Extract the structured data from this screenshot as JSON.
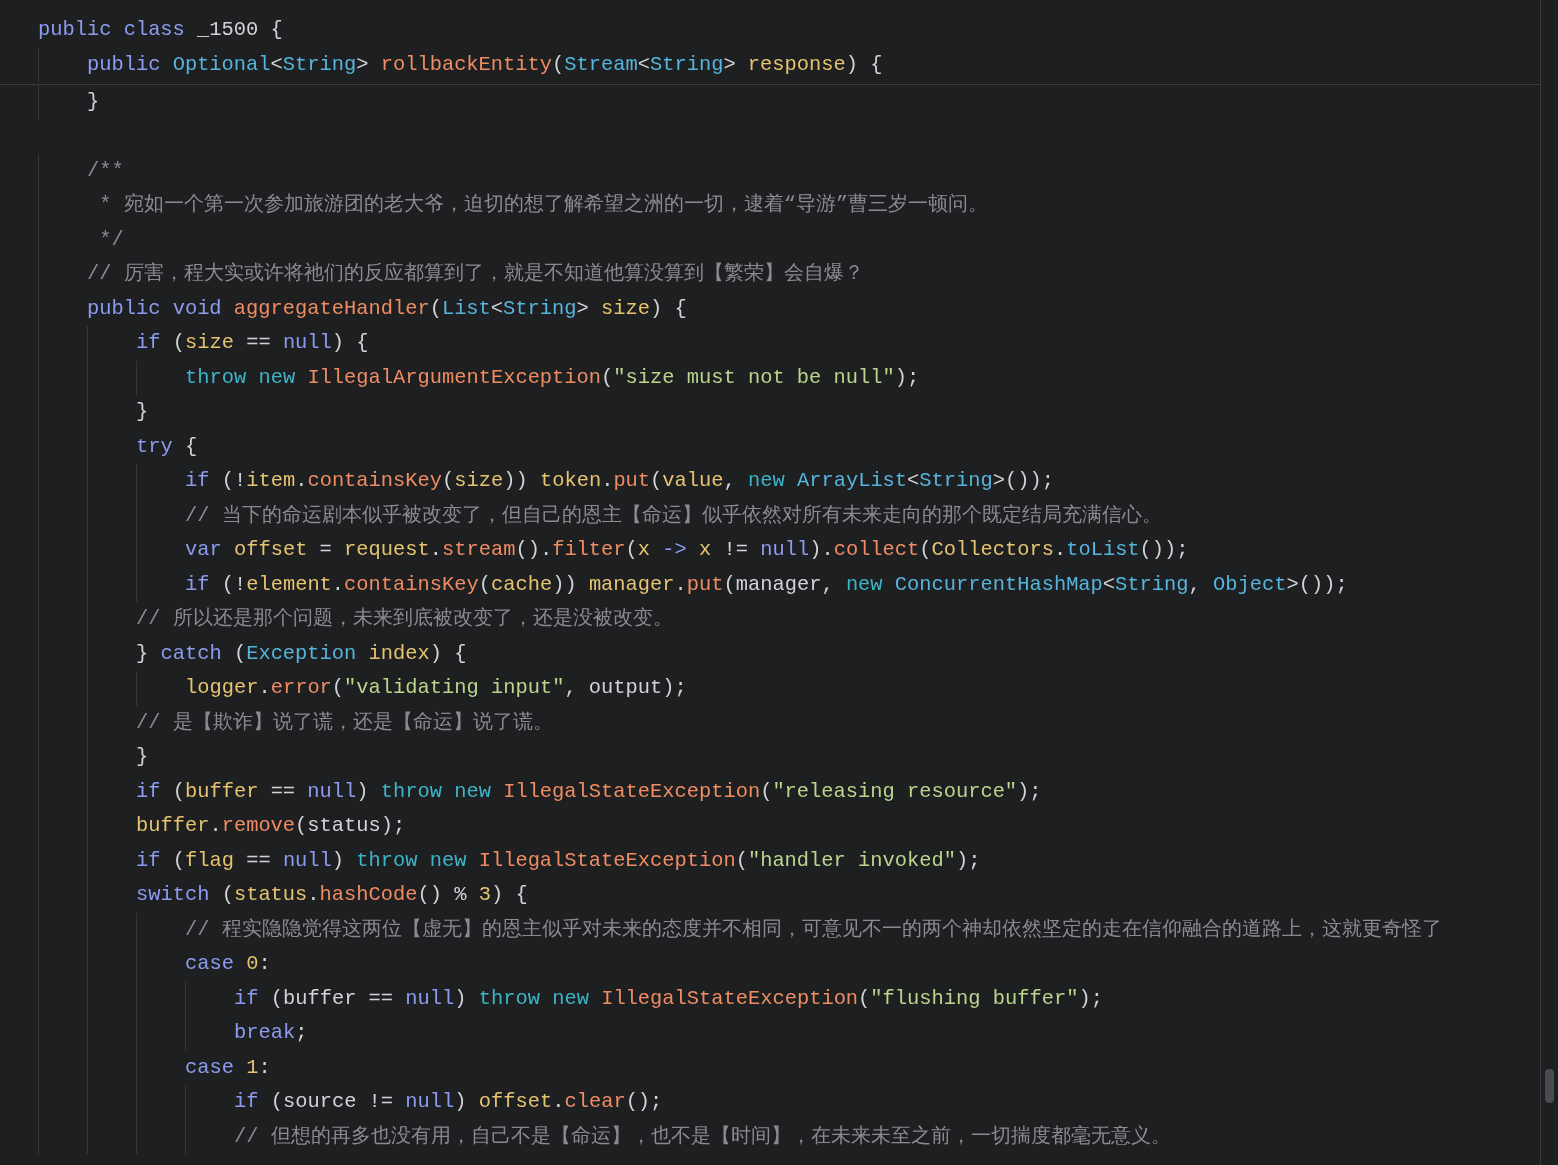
{
  "sticky_header": {
    "lines": [
      {
        "tokens": [
          {
            "kind": "kw",
            "text": "public "
          },
          {
            "kind": "kw",
            "text": "class "
          },
          {
            "kind": "p",
            "text": "_1500 {"
          }
        ]
      },
      {
        "tokens": [
          {
            "kind": "kw",
            "text": "    public "
          },
          {
            "kind": "type",
            "text": "Optional"
          },
          {
            "kind": "p",
            "text": "<"
          },
          {
            "kind": "type",
            "text": "String"
          },
          {
            "kind": "p",
            "text": "> "
          },
          {
            "kind": "fn",
            "text": "rollbackEntity"
          },
          {
            "kind": "p",
            "text": "("
          },
          {
            "kind": "type",
            "text": "Stream"
          },
          {
            "kind": "p",
            "text": "<"
          },
          {
            "kind": "type",
            "text": "String"
          },
          {
            "kind": "p",
            "text": "> "
          },
          {
            "kind": "var",
            "text": "response"
          },
          {
            "kind": "p",
            "text": ") {"
          }
        ]
      }
    ]
  },
  "editor": {
    "lines": [
      {
        "tokens": [
          {
            "kind": "p",
            "text": "    }"
          }
        ]
      },
      {
        "kind": "blank"
      },
      {
        "tokens": [
          {
            "kind": "cm",
            "text": "    /**"
          }
        ]
      },
      {
        "tokens": [
          {
            "kind": "cm",
            "text": "     * 宛如一个第一次参加旅游团的老大爷，迫切的想了解希望之洲的一切，逮着“导游”曹三岁一顿问。"
          }
        ]
      },
      {
        "tokens": [
          {
            "kind": "cm",
            "text": "     */"
          }
        ]
      },
      {
        "tokens": [
          {
            "kind": "cm",
            "text": "    // 厉害，程大实或许将祂们的反应都算到了，就是不知道他算没算到【繁荣】会自爆？"
          }
        ]
      },
      {
        "tokens": [
          {
            "kind": "kw",
            "text": "    public "
          },
          {
            "kind": "kw",
            "text": "void "
          },
          {
            "kind": "fn",
            "text": "aggregateHandler"
          },
          {
            "kind": "p",
            "text": "("
          },
          {
            "kind": "type",
            "text": "List"
          },
          {
            "kind": "p",
            "text": "<"
          },
          {
            "kind": "type",
            "text": "String"
          },
          {
            "kind": "p",
            "text": "> "
          },
          {
            "kind": "var",
            "text": "size"
          },
          {
            "kind": "p",
            "text": ") {"
          }
        ]
      },
      {
        "tokens": [
          {
            "kind": "kw",
            "text": "        if"
          },
          {
            "kind": "p",
            "text": " ("
          },
          {
            "kind": "var",
            "text": "size"
          },
          {
            "kind": "p",
            "text": " == "
          },
          {
            "kind": "kw",
            "text": "null"
          },
          {
            "kind": "p",
            "text": ") {"
          }
        ]
      },
      {
        "tokens": [
          {
            "kind": "kw2",
            "text": "            throw "
          },
          {
            "kind": "kw2",
            "text": "new "
          },
          {
            "kind": "fn",
            "text": "IllegalArgumentException"
          },
          {
            "kind": "p",
            "text": "("
          },
          {
            "kind": "str",
            "text": "\"size must not be null\""
          },
          {
            "kind": "p",
            "text": ");"
          }
        ]
      },
      {
        "tokens": [
          {
            "kind": "p",
            "text": "        }"
          }
        ]
      },
      {
        "tokens": [
          {
            "kind": "kw",
            "text": "        try"
          },
          {
            "kind": "p",
            "text": " {"
          }
        ]
      },
      {
        "tokens": [
          {
            "kind": "kw",
            "text": "            if"
          },
          {
            "kind": "p",
            "text": " (!"
          },
          {
            "kind": "var",
            "text": "item"
          },
          {
            "kind": "p",
            "text": "."
          },
          {
            "kind": "fn",
            "text": "containsKey"
          },
          {
            "kind": "p",
            "text": "("
          },
          {
            "kind": "var",
            "text": "size"
          },
          {
            "kind": "p",
            "text": ")) "
          },
          {
            "kind": "var",
            "text": "token"
          },
          {
            "kind": "p",
            "text": "."
          },
          {
            "kind": "fn",
            "text": "put"
          },
          {
            "kind": "p",
            "text": "("
          },
          {
            "kind": "var",
            "text": "value"
          },
          {
            "kind": "p",
            "text": ", "
          },
          {
            "kind": "kw2",
            "text": "new "
          },
          {
            "kind": "type",
            "text": "ArrayList"
          },
          {
            "kind": "p",
            "text": "<"
          },
          {
            "kind": "type",
            "text": "String"
          },
          {
            "kind": "p",
            "text": ">());"
          }
        ]
      },
      {
        "tokens": [
          {
            "kind": "cm",
            "text": "            // 当下的命运剧本似乎被改变了，但自己的恩主【命运】似乎依然对所有未来走向的那个既定结局充满信心。"
          }
        ]
      },
      {
        "tokens": [
          {
            "kind": "kw",
            "text": "            var "
          },
          {
            "kind": "var",
            "text": "offset"
          },
          {
            "kind": "p",
            "text": " = "
          },
          {
            "kind": "var",
            "text": "request"
          },
          {
            "kind": "p",
            "text": "."
          },
          {
            "kind": "fn",
            "text": "stream"
          },
          {
            "kind": "p",
            "text": "()."
          },
          {
            "kind": "fn",
            "text": "filter"
          },
          {
            "kind": "p",
            "text": "("
          },
          {
            "kind": "var",
            "text": "x "
          },
          {
            "kind": "kw",
            "text": "-> "
          },
          {
            "kind": "var",
            "text": "x"
          },
          {
            "kind": "p",
            "text": " != "
          },
          {
            "kind": "kw",
            "text": "null"
          },
          {
            "kind": "p",
            "text": ")."
          },
          {
            "kind": "fn",
            "text": "collect"
          },
          {
            "kind": "p",
            "text": "("
          },
          {
            "kind": "var",
            "text": "Collectors"
          },
          {
            "kind": "p",
            "text": "."
          },
          {
            "kind": "type",
            "text": "toList"
          },
          {
            "kind": "p",
            "text": "());"
          }
        ]
      },
      {
        "tokens": [
          {
            "kind": "kw",
            "text": "            if"
          },
          {
            "kind": "p",
            "text": " (!"
          },
          {
            "kind": "var",
            "text": "element"
          },
          {
            "kind": "p",
            "text": "."
          },
          {
            "kind": "fn",
            "text": "containsKey"
          },
          {
            "kind": "p",
            "text": "("
          },
          {
            "kind": "var",
            "text": "cache"
          },
          {
            "kind": "p",
            "text": ")) "
          },
          {
            "kind": "var",
            "text": "manager"
          },
          {
            "kind": "p",
            "text": "."
          },
          {
            "kind": "fn",
            "text": "put"
          },
          {
            "kind": "p",
            "text": "(manager, "
          },
          {
            "kind": "kw2",
            "text": "new "
          },
          {
            "kind": "type",
            "text": "ConcurrentHashMap"
          },
          {
            "kind": "p",
            "text": "<"
          },
          {
            "kind": "type",
            "text": "String"
          },
          {
            "kind": "p",
            "text": ", "
          },
          {
            "kind": "type",
            "text": "Object"
          },
          {
            "kind": "p",
            "text": ">());"
          }
        ]
      },
      {
        "tokens": [
          {
            "kind": "cm",
            "text": "        // 所以还是那个问题，未来到底被改变了，还是没被改变。"
          }
        ]
      },
      {
        "tokens": [
          {
            "kind": "p",
            "text": "        } "
          },
          {
            "kind": "kw",
            "text": "catch"
          },
          {
            "kind": "p",
            "text": " ("
          },
          {
            "kind": "type",
            "text": "Exception "
          },
          {
            "kind": "var",
            "text": "index"
          },
          {
            "kind": "p",
            "text": ") {"
          }
        ]
      },
      {
        "tokens": [
          {
            "kind": "var",
            "text": "            logger"
          },
          {
            "kind": "p",
            "text": "."
          },
          {
            "kind": "fn",
            "text": "error"
          },
          {
            "kind": "p",
            "text": "("
          },
          {
            "kind": "str",
            "text": "\"validating input\""
          },
          {
            "kind": "p",
            "text": ", output);"
          }
        ]
      },
      {
        "tokens": [
          {
            "kind": "cm",
            "text": "        // 是【欺诈】说了谎，还是【命运】说了谎。"
          }
        ]
      },
      {
        "tokens": [
          {
            "kind": "p",
            "text": "        }"
          }
        ]
      },
      {
        "tokens": [
          {
            "kind": "kw",
            "text": "        if"
          },
          {
            "kind": "p",
            "text": " ("
          },
          {
            "kind": "var",
            "text": "buffer"
          },
          {
            "kind": "p",
            "text": " == "
          },
          {
            "kind": "kw",
            "text": "null"
          },
          {
            "kind": "p",
            "text": ") "
          },
          {
            "kind": "kw2",
            "text": "throw "
          },
          {
            "kind": "kw2",
            "text": "new "
          },
          {
            "kind": "fn",
            "text": "IllegalStateException"
          },
          {
            "kind": "p",
            "text": "("
          },
          {
            "kind": "str",
            "text": "\"releasing resource\""
          },
          {
            "kind": "p",
            "text": ");"
          }
        ]
      },
      {
        "tokens": [
          {
            "kind": "var",
            "text": "        buffer"
          },
          {
            "kind": "p",
            "text": "."
          },
          {
            "kind": "fn",
            "text": "remove"
          },
          {
            "kind": "p",
            "text": "(status);"
          }
        ]
      },
      {
        "tokens": [
          {
            "kind": "kw",
            "text": "        if"
          },
          {
            "kind": "p",
            "text": " ("
          },
          {
            "kind": "var",
            "text": "flag"
          },
          {
            "kind": "p",
            "text": " == "
          },
          {
            "kind": "kw",
            "text": "null"
          },
          {
            "kind": "p",
            "text": ") "
          },
          {
            "kind": "kw2",
            "text": "throw "
          },
          {
            "kind": "kw2",
            "text": "new "
          },
          {
            "kind": "fn",
            "text": "IllegalStateException"
          },
          {
            "kind": "p",
            "text": "("
          },
          {
            "kind": "str",
            "text": "\"handler invoked\""
          },
          {
            "kind": "p",
            "text": ");"
          }
        ]
      },
      {
        "tokens": [
          {
            "kind": "kw",
            "text": "        switch"
          },
          {
            "kind": "p",
            "text": " ("
          },
          {
            "kind": "var",
            "text": "status"
          },
          {
            "kind": "p",
            "text": "."
          },
          {
            "kind": "fn",
            "text": "hashCode"
          },
          {
            "kind": "p",
            "text": "() % "
          },
          {
            "kind": "num",
            "text": "3"
          },
          {
            "kind": "p",
            "text": ") {"
          }
        ]
      },
      {
        "tokens": [
          {
            "kind": "cm",
            "text": "            // 程实隐隐觉得这两位【虚无】的恩主似乎对未来的态度并不相同，可意见不一的两个神却依然坚定的走在信仰融合的道路上，这就更奇怪了"
          }
        ]
      },
      {
        "tokens": [
          {
            "kind": "kw",
            "text": "            case "
          },
          {
            "kind": "num",
            "text": "0"
          },
          {
            "kind": "p",
            "text": ":"
          }
        ]
      },
      {
        "tokens": [
          {
            "kind": "kw",
            "text": "                if"
          },
          {
            "kind": "p",
            "text": " (buffer == "
          },
          {
            "kind": "kw",
            "text": "null"
          },
          {
            "kind": "p",
            "text": ") "
          },
          {
            "kind": "kw2",
            "text": "throw "
          },
          {
            "kind": "kw2",
            "text": "new "
          },
          {
            "kind": "fn",
            "text": "IllegalStateException"
          },
          {
            "kind": "p",
            "text": "("
          },
          {
            "kind": "str",
            "text": "\"flushing buffer\""
          },
          {
            "kind": "p",
            "text": ");"
          }
        ]
      },
      {
        "tokens": [
          {
            "kind": "kw",
            "text": "                break"
          },
          {
            "kind": "p",
            "text": ";"
          }
        ]
      },
      {
        "tokens": [
          {
            "kind": "kw",
            "text": "            case "
          },
          {
            "kind": "num",
            "text": "1"
          },
          {
            "kind": "p",
            "text": ":"
          }
        ]
      },
      {
        "tokens": [
          {
            "kind": "kw",
            "text": "                if"
          },
          {
            "kind": "p",
            "text": " (source != "
          },
          {
            "kind": "kw",
            "text": "null"
          },
          {
            "kind": "p",
            "text": ") "
          },
          {
            "kind": "var",
            "text": "offset"
          },
          {
            "kind": "p",
            "text": "."
          },
          {
            "kind": "fn",
            "text": "clear"
          },
          {
            "kind": "p",
            "text": "();"
          }
        ]
      },
      {
        "tokens": [
          {
            "kind": "cm",
            "text": "                // 但想的再多也没有用，自己不是【命运】，也不是【时间】，在未来未至之前，一切揣度都毫无意义。"
          }
        ]
      }
    ]
  }
}
